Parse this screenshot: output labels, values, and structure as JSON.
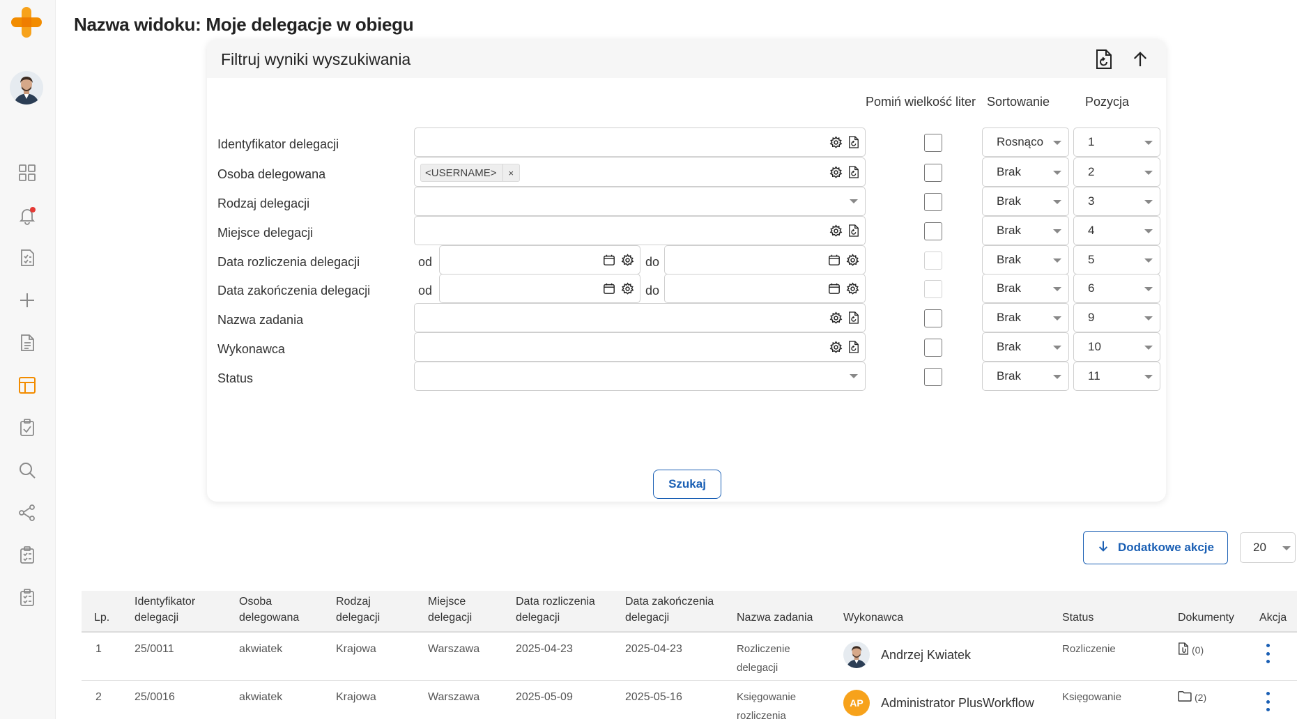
{
  "page": {
    "title": "Nazwa widoku: Moje delegacje w obiegu"
  },
  "sidebar": {
    "icons": [
      "plus-logo-icon",
      "user-avatar",
      "dashboard-grid-icon",
      "bell-icon",
      "checklist-icon",
      "plus-icon",
      "document-icon",
      "layout-icon",
      "clipboard-check-icon",
      "search-icon",
      "share-icon",
      "clipboard-list-icon",
      "clipboard-list-icon"
    ],
    "accent": "#f28c00"
  },
  "filter": {
    "title": "Filtruj wyniki wyszukiwania",
    "columns": {
      "ignore_case": "Pomiń wielkość liter",
      "sorting": "Sortowanie",
      "position": "Pozycja"
    },
    "rows": [
      {
        "label": "Identyfikator delegacji",
        "type": "text",
        "value": "",
        "sort": "Rosnąco",
        "position": "1"
      },
      {
        "label": "Osoba delegowana",
        "type": "chip",
        "chip": "<USERNAME>",
        "chip_remove": "×",
        "sort": "Brak",
        "position": "2"
      },
      {
        "label": "Rodzaj delegacji",
        "type": "select",
        "value": "",
        "sort": "Brak",
        "position": "3"
      },
      {
        "label": "Miejsce delegacji",
        "type": "text",
        "value": "",
        "sort": "Brak",
        "position": "4"
      },
      {
        "label": "Data rozliczenia delegacji",
        "type": "daterange",
        "from_label": "od",
        "to_label": "do",
        "sort": "Brak",
        "position": "5"
      },
      {
        "label": "Data zakończenia delegacji",
        "type": "daterange",
        "from_label": "od",
        "to_label": "do",
        "sort": "Brak",
        "position": "6"
      },
      {
        "label": "Nazwa zadania",
        "type": "text",
        "value": "",
        "sort": "Brak",
        "position": "9"
      },
      {
        "label": "Wykonawca",
        "type": "text",
        "value": "",
        "sort": "Brak",
        "position": "10"
      },
      {
        "label": "Status",
        "type": "select",
        "value": "",
        "sort": "Brak",
        "position": "11"
      }
    ],
    "search_button": "Szukaj"
  },
  "actions": {
    "extra_button": "Dodatkowe akcje",
    "page_size": "20"
  },
  "table": {
    "headers": {
      "lp": "Lp.",
      "id": [
        "Identyfikator",
        "delegacji"
      ],
      "person": [
        "Osoba",
        "delegowana"
      ],
      "kind": [
        "Rodzaj",
        "delegacji"
      ],
      "place": [
        "Miejsce",
        "delegacji"
      ],
      "settle_date": [
        "Data rozliczenia",
        "delegacji"
      ],
      "end_date": [
        "Data zakończenia",
        "delegacji"
      ],
      "task": "Nazwa zadania",
      "executor": "Wykonawca",
      "status": "Status",
      "docs": "Dokumenty",
      "action": "Akcja"
    },
    "rows": [
      {
        "lp": "1",
        "id": "25/0011",
        "person": "akwiatek",
        "kind": "Krajowa",
        "place": "Warszawa",
        "settle_date": "2025-04-23",
        "end_date": "2025-04-23",
        "task": [
          "Rozliczenie",
          "delegacji"
        ],
        "executor": "Andrzej Kwiatek",
        "executor_avatar": "photo",
        "status": "Rozliczenie",
        "docs": "(0)",
        "docs_icon": "file-clip-icon"
      },
      {
        "lp": "2",
        "id": "25/0016",
        "person": "akwiatek",
        "kind": "Krajowa",
        "place": "Warszawa",
        "settle_date": "2025-05-09",
        "end_date": "2025-05-16",
        "task": [
          "Księgowanie",
          "rozliczenia"
        ],
        "executor": "Administrator PlusWorkflow",
        "executor_avatar": "AP",
        "status": "Księgowanie",
        "docs": "(2)",
        "docs_icon": "folder-icon"
      }
    ]
  },
  "colors": {
    "primary_blue": "#1a5fb4",
    "brand_orange": "#f28c00",
    "avatar_orange": "#f7a21b",
    "notification_red": "#e53935"
  }
}
